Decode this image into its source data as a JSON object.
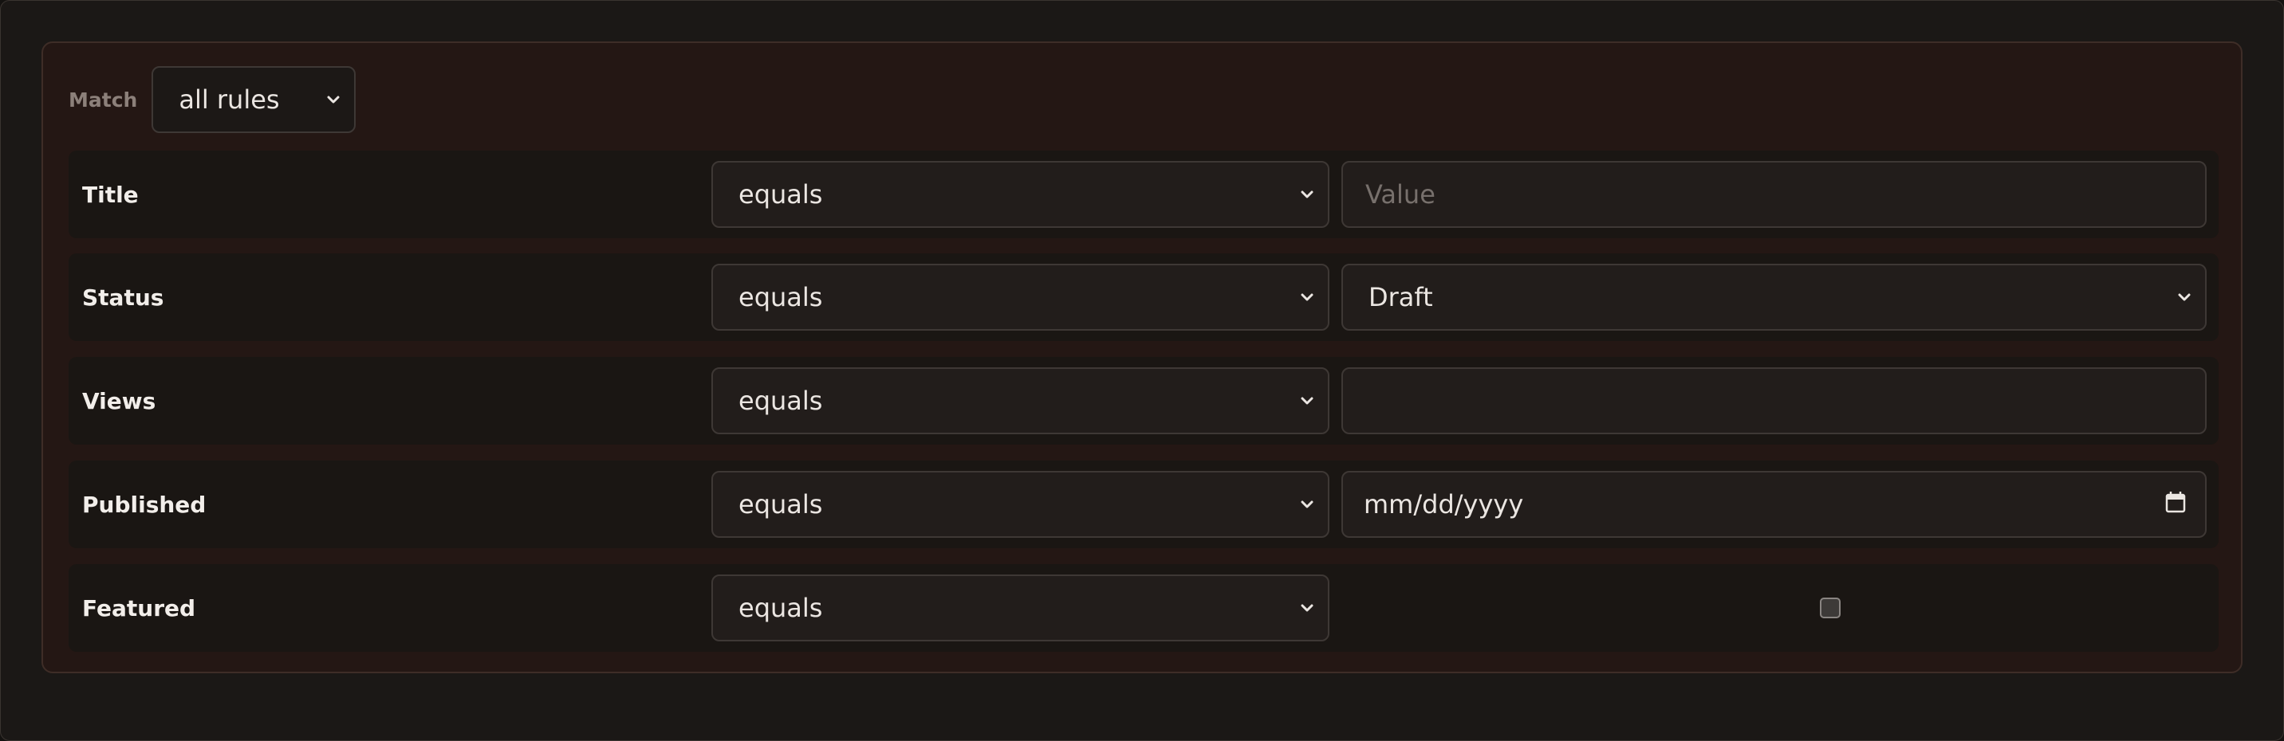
{
  "match": {
    "label": "Match",
    "selected": "all rules"
  },
  "rules": [
    {
      "field": "Title",
      "operator": "equals",
      "value_placeholder": "Value",
      "value_kind": "text"
    },
    {
      "field": "Status",
      "operator": "equals",
      "value": "Draft",
      "value_kind": "select"
    },
    {
      "field": "Views",
      "operator": "equals",
      "value": "",
      "value_kind": "number"
    },
    {
      "field": "Published",
      "operator": "equals",
      "value_placeholder": "mm/dd/yyyy",
      "value_kind": "date"
    },
    {
      "field": "Featured",
      "operator": "equals",
      "checked": false,
      "value_kind": "checkbox"
    }
  ],
  "icons": {
    "dropdown": "chevron-down-icon",
    "calendar": "calendar-icon"
  }
}
